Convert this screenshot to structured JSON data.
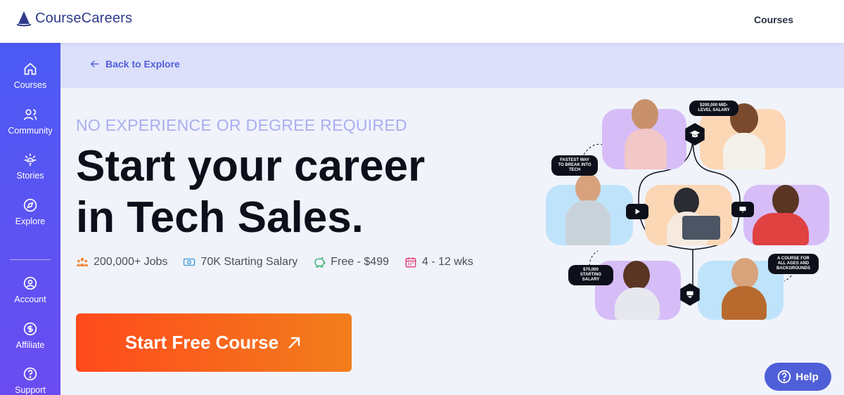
{
  "header": {
    "logo_text": "CourseCareers",
    "nav_courses": "Courses"
  },
  "sidebar": {
    "items": [
      {
        "label": "Courses",
        "icon": "home-icon"
      },
      {
        "label": "Community",
        "icon": "users-icon"
      },
      {
        "label": "Stories",
        "icon": "sparkle-icon"
      },
      {
        "label": "Explore",
        "icon": "compass-icon"
      },
      {
        "label": "Account",
        "icon": "user-circle-icon"
      },
      {
        "label": "Affiliate",
        "icon": "dollar-circle-icon"
      },
      {
        "label": "Support",
        "icon": "question-circle-icon"
      }
    ]
  },
  "back": {
    "label": "Back to Explore"
  },
  "hero": {
    "eyebrow": "NO EXPERIENCE OR DEGREE REQUIRED",
    "headline_line1": "Start your career",
    "headline_line2": "in Tech Sales.",
    "stats": [
      {
        "label": "200,000+ Jobs",
        "icon": "people-icon",
        "color": "#f08a3c"
      },
      {
        "label": "70K Starting Salary",
        "icon": "money-icon",
        "color": "#4aa3d9"
      },
      {
        "label": "Free - $499",
        "icon": "piggy-bank-icon",
        "color": "#3bb273"
      },
      {
        "label": "4 - 12 wks",
        "icon": "calendar-icon",
        "color": "#e0467a"
      }
    ],
    "cta_label": "Start Free Course"
  },
  "illustration": {
    "tags": [
      "$200,000 MID-LEVEL SALARY",
      "FASTEST WAY TO BREAK INTO TECH",
      "A COURSE FOR ALL AGES AND BACKGROUNDS",
      "$70,000 STARTING SALARY"
    ]
  },
  "help": {
    "label": "Help"
  },
  "colors": {
    "accent": "#4f5fd8",
    "sidebar_top": "#4c5bf5",
    "cta_start": "#ff4a1c",
    "cta_end": "#f27e1c"
  }
}
